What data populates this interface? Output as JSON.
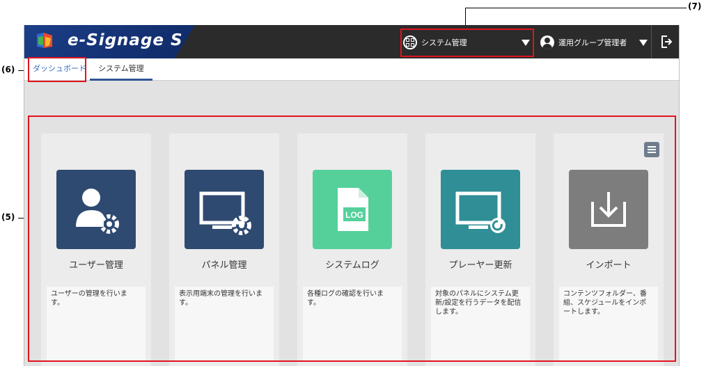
{
  "annotations": {
    "callout_5": "(5)",
    "callout_6": "(6)",
    "callout_7": "(7)"
  },
  "header": {
    "app_title": "e-Signage S",
    "system_selector": "システム管理",
    "user_role": "運用グループ管理者"
  },
  "tabs": [
    {
      "label": "ダッシュボード"
    },
    {
      "label": "システム管理"
    }
  ],
  "cards": [
    {
      "title": "ユーザー管理",
      "desc": "ユーザーの管理を行いま\nす。",
      "color": "#2f4a70",
      "icon": "user-gear-icon"
    },
    {
      "title": "パネル管理",
      "desc": "表示用端末の管理を行いま\nす。",
      "color": "#2f4a70",
      "icon": "monitor-gear-icon"
    },
    {
      "title": "システムログ",
      "desc": "各種ログの確認を行いま\nす。",
      "color": "#55d09b",
      "icon": "log-file-icon"
    },
    {
      "title": "プレーヤー更新",
      "desc": "対象のパネルにシステム更\n新/設定を行うデータを配信\nします。",
      "color": "#2f8e96",
      "icon": "monitor-refresh-icon"
    },
    {
      "title": "インポート",
      "desc": "コンテンツフォルダー、番\n組、スケジュールをインポ\nートします。",
      "color": "#7d7d7d",
      "icon": "import-icon"
    }
  ],
  "colors": {
    "annotation_red": "#e0141e",
    "topbar": "#2b2b2b",
    "brand_blue": "#1c3f88",
    "tab_link": "#3a6cc0"
  }
}
